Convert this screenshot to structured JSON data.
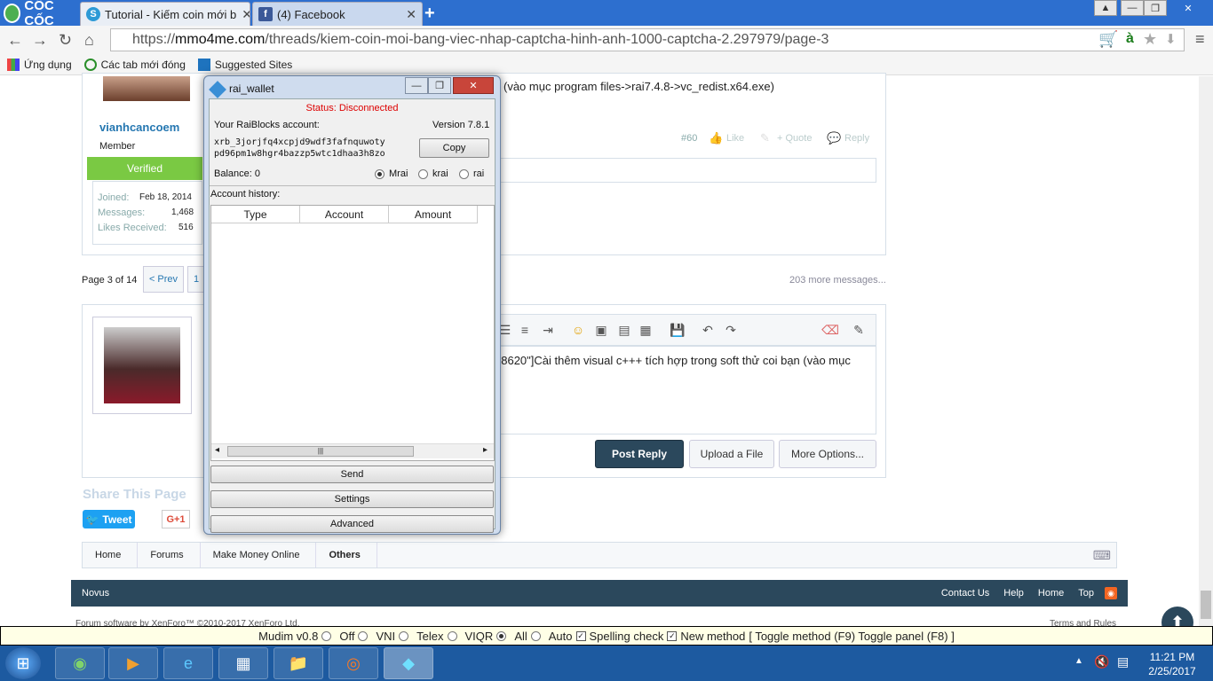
{
  "browser": {
    "brand": "CỐC CỐC",
    "tabs": [
      {
        "label": "Tutorial - Kiếm coin mới b"
      },
      {
        "label": "(4) Facebook"
      }
    ],
    "url_prefix": "https://",
    "url_host": "mmo4me.com",
    "url_path": "/threads/kiem-coin-moi-bang-viec-nhap-captcha-hinh-anh-1000-captcha-2.297979/page-3",
    "bookmarks": [
      "Ứng dụng",
      "Các tab mới đóng",
      "Suggested Sites"
    ]
  },
  "post": {
    "username": "vianhcancoem",
    "role": "Member",
    "badge": "Verified",
    "stats": [
      {
        "k": "Joined:",
        "v": "Feb 18, 2014"
      },
      {
        "k": "Messages:",
        "v": "1,468"
      },
      {
        "k": "Likes Received:",
        "v": "516"
      }
    ],
    "text": "(vào mục program files->rai7.4.8->vc_redist.x64.exe)",
    "number": "#60",
    "like": "Like",
    "quote": "+ Quote",
    "reply": "Reply"
  },
  "pagination": {
    "label": "Page 3 of 14",
    "prev": "< Prev",
    "first": "1",
    "more": "203 more messages..."
  },
  "editor": {
    "line1": "68620\"]Cài thêm visual c+++ tích hợp trong soft thử coi bạn (vào mục",
    "line2": "]",
    "post_reply": "Post Reply",
    "upload": "Upload a File",
    "more_options": "More Options..."
  },
  "share": {
    "title": "Share This Page",
    "tweet": "Tweet",
    "gplus": "G+1"
  },
  "breadcrumb": [
    "Home",
    "Forums",
    "Make Money Online",
    "Others"
  ],
  "footer": {
    "left": "Novus",
    "links": [
      "Contact Us",
      "Help",
      "Home",
      "Top"
    ],
    "copyright": "Forum software by XenForo™ ©2010-2017 XenForo Ltd.",
    "terms": "Terms and Rules"
  },
  "wallet": {
    "title": "rai_wallet",
    "status": "Status: Disconnected",
    "account_label": "Your RaiBlocks account:",
    "version": "Version 7.8.1",
    "address_line1": "xrb_3jorjfq4xcpjd9wdf3fafnquwoty",
    "address_line2": "pd96pm1w8hgr4bazzp5wtc1dhaa3h8zo",
    "copy": "Copy",
    "balance": "Balance: 0",
    "units": [
      "Mrai",
      "krai",
      "rai"
    ],
    "selected_unit": "Mrai",
    "history_label": "Account history:",
    "columns": [
      "Type",
      "Account",
      "Amount"
    ],
    "buttons": [
      "Send",
      "Settings",
      "Advanced"
    ]
  },
  "mudim": {
    "version": "Mudim v0.8",
    "options": [
      "Off",
      "VNI",
      "Telex",
      "VIQR",
      "All",
      "Auto"
    ],
    "selected": "All",
    "spelling": "Spelling check",
    "new_method": "New method",
    "toggle": "[ Toggle method (F9) Toggle panel (F8) ]"
  },
  "taskbar": {
    "time": "11:21 PM",
    "date": "2/25/2017"
  }
}
